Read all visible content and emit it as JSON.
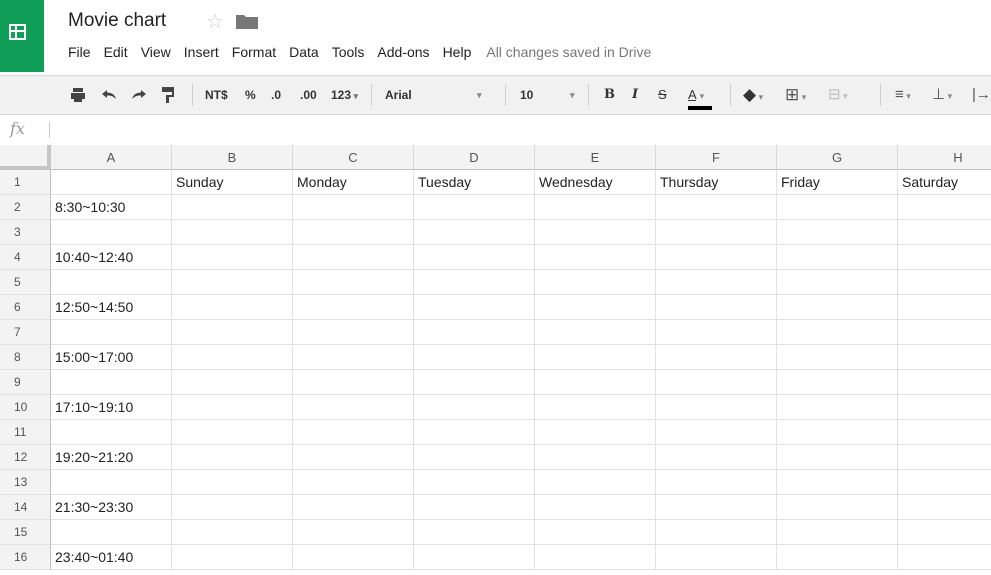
{
  "app": {
    "title": "Movie chart",
    "star_icon": "star-icon",
    "folder_icon": "folder-icon",
    "saved_status": "All changes saved in Drive",
    "brand_color": "#0f9d58"
  },
  "menu": [
    "File",
    "Edit",
    "View",
    "Insert",
    "Format",
    "Data",
    "Tools",
    "Add-ons",
    "Help"
  ],
  "toolbar": {
    "currency_label": "NT$",
    "percent_label": "%",
    "decrease_decimal_label": ".0",
    "increase_decimal_label": ".00",
    "more_formats_label": "123",
    "font_name": "Arial",
    "font_size": "10",
    "bold_label": "B",
    "italic_label": "I",
    "strikethrough_label": "S",
    "text_color_label": "A"
  },
  "formula_bar": {
    "fx_label": "fx",
    "value": ""
  },
  "sheet": {
    "columns": [
      "A",
      "B",
      "C",
      "D",
      "E",
      "F",
      "G",
      "H"
    ],
    "rows": [
      {
        "num": "1",
        "cells": [
          "",
          "Sunday",
          "Monday",
          "Tuesday",
          "Wednesday",
          "Thursday",
          "Friday",
          "Saturday"
        ]
      },
      {
        "num": "2",
        "cells": [
          "8:30~10:30",
          "",
          "",
          "",
          "",
          "",
          "",
          ""
        ]
      },
      {
        "num": "3",
        "cells": [
          "",
          "",
          "",
          "",
          "",
          "",
          "",
          ""
        ]
      },
      {
        "num": "4",
        "cells": [
          "10:40~12:40",
          "",
          "",
          "",
          "",
          "",
          "",
          ""
        ]
      },
      {
        "num": "5",
        "cells": [
          "",
          "",
          "",
          "",
          "",
          "",
          "",
          ""
        ]
      },
      {
        "num": "6",
        "cells": [
          "12:50~14:50",
          "",
          "",
          "",
          "",
          "",
          "",
          ""
        ]
      },
      {
        "num": "7",
        "cells": [
          "",
          "",
          "",
          "",
          "",
          "",
          "",
          ""
        ]
      },
      {
        "num": "8",
        "cells": [
          "15:00~17:00",
          "",
          "",
          "",
          "",
          "",
          "",
          ""
        ]
      },
      {
        "num": "9",
        "cells": [
          "",
          "",
          "",
          "",
          "",
          "",
          "",
          ""
        ]
      },
      {
        "num": "10",
        "cells": [
          "17:10~19:10",
          "",
          "",
          "",
          "",
          "",
          "",
          ""
        ]
      },
      {
        "num": "11",
        "cells": [
          "",
          "",
          "",
          "",
          "",
          "",
          "",
          ""
        ]
      },
      {
        "num": "12",
        "cells": [
          "19:20~21:20",
          "",
          "",
          "",
          "",
          "",
          "",
          ""
        ]
      },
      {
        "num": "13",
        "cells": [
          "",
          "",
          "",
          "",
          "",
          "",
          "",
          ""
        ]
      },
      {
        "num": "14",
        "cells": [
          "21:30~23:30",
          "",
          "",
          "",
          "",
          "",
          "",
          ""
        ]
      },
      {
        "num": "15",
        "cells": [
          "",
          "",
          "",
          "",
          "",
          "",
          "",
          ""
        ]
      },
      {
        "num": "16",
        "cells": [
          "23:40~01:40",
          "",
          "",
          "",
          "",
          "",
          "",
          ""
        ]
      }
    ]
  }
}
